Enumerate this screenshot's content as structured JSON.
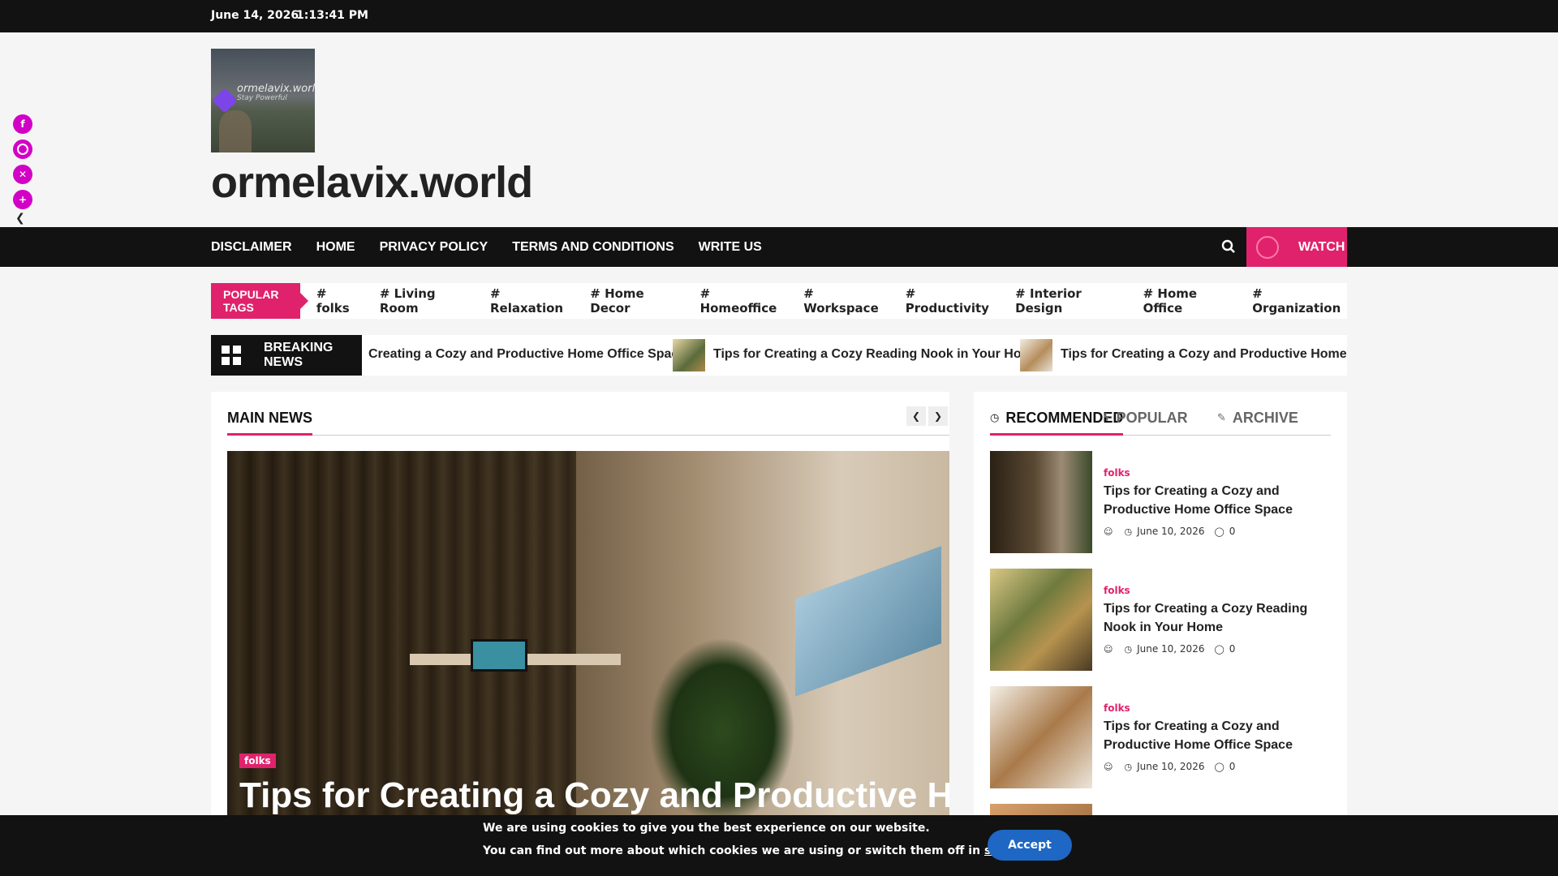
{
  "topbar": {
    "date": "June 14, 2026",
    "time": "1:13:41 PM"
  },
  "social": {
    "icons": [
      "facebook-icon",
      "instagram-icon",
      "x-icon",
      "share-plus-icon"
    ]
  },
  "site": {
    "logo_text": "ormelavix.world",
    "logo_tagline": "Stay Powerful",
    "title": "ormelavix.world"
  },
  "nav": {
    "items": [
      "DISCLAIMER",
      "HOME",
      "PRIVACY POLICY",
      "TERMS AND CONDITIONS",
      "WRITE US"
    ],
    "watch_label": "WATCH"
  },
  "tags": {
    "label": "POPULAR TAGS",
    "items": [
      "# folks",
      "# Living Room",
      "# Relaxation",
      "# Home Decor",
      "# Homeoffice",
      "# Workspace",
      "# Productivity",
      "# Interior Design",
      "# Home Office",
      "# Organization"
    ]
  },
  "breaking": {
    "label": "BREAKING NEWS",
    "items": [
      "Creating a Cozy and Productive Home Office Space",
      "Tips for Creating a Cozy Reading Nook in Your Home",
      "Tips for Creating a Cozy and Productive Home Office"
    ]
  },
  "main_news": {
    "heading": "MAIN NEWS",
    "hero": {
      "category": "folks",
      "title": "Tips for Creating a Cozy and Productive Home"
    }
  },
  "sidebar": {
    "tabs": [
      "RECOMMENDED",
      "POPULAR",
      "ARCHIVE"
    ],
    "posts": [
      {
        "category": "folks",
        "title": "Tips for Creating a Cozy and Productive Home Office Space",
        "date": "June 10, 2026",
        "comments": "0"
      },
      {
        "category": "folks",
        "title": "Tips for Creating a Cozy Reading Nook in Your Home",
        "date": "June 10, 2026",
        "comments": "0"
      },
      {
        "category": "folks",
        "title": "Tips for Creating a Cozy and Productive Home Office Space",
        "date": "June 10, 2026",
        "comments": "0"
      }
    ]
  },
  "cookie": {
    "line1": "We are using cookies to give you the best experience on our website.",
    "line2_prefix": "You can find out more about which cookies we are using or switch them off in",
    "line2_link": "settings",
    "line2_suffix": ".",
    "accept_label": "Accept"
  },
  "colors": {
    "accent": "#e0226c",
    "dark": "#121212",
    "button": "#1e67c4"
  }
}
